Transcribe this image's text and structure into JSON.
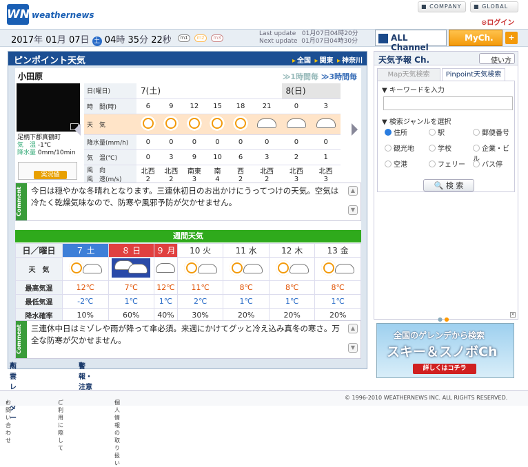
{
  "header": {
    "logo_text": "weathernews",
    "logo_mark": "WN",
    "company": "COMPANY",
    "global": "GLOBAL",
    "login": "ログイン"
  },
  "datebar": {
    "year": "2017",
    "nen": "年",
    "month": "01",
    "gatsu": "月",
    "day": "07",
    "nichi": "日",
    "weekday": "土",
    "hour": "04",
    "ji": "時",
    "minute": "35",
    "fun": "分",
    "second": "22",
    "byo": "秒",
    "pills": [
      "m1",
      "m2",
      "m3"
    ],
    "last_update_label": "Last update",
    "last_update": "01月07日04時20分",
    "next_update_label": "Next update",
    "next_update": "01月07日04時30分",
    "all_channel": "ALL Channel",
    "mych": "MyCh.",
    "plus": "+"
  },
  "main": {
    "title": "ピンポイント天気",
    "breadcrumb": [
      "全国",
      "関東",
      "神奈川"
    ],
    "city": "小田原",
    "tab_1h": "1時間毎",
    "tab_3h": "3時間毎"
  },
  "camera": {
    "station": "足柄下郡真鶴町",
    "temp_label": "気　温",
    "temp": "-1℃",
    "rain_label": "降水量",
    "rain": "0mm/10min",
    "live": "実況値"
  },
  "hourly": {
    "labels": [
      "日(曜日)",
      "時　間(時)",
      "天　気",
      "降水量(mm/h)",
      "気　温(℃)",
      "風　向",
      "風　速(m/s)"
    ],
    "day1": "7(土)",
    "day2": "8(日)",
    "hours": [
      "6",
      "9",
      "12",
      "15",
      "18",
      "21",
      "0",
      "3"
    ],
    "weather": [
      "sun",
      "sun",
      "sun",
      "sun",
      "sun",
      "cloud",
      "cloud",
      "cloud"
    ],
    "precip": [
      "0",
      "0",
      "0",
      "0",
      "0",
      "0",
      "0",
      "0"
    ],
    "temp": [
      "0",
      "3",
      "9",
      "10",
      "6",
      "3",
      "2",
      "1"
    ],
    "wind_dir": [
      "北西",
      "北西",
      "南東",
      "南",
      "西",
      "北西",
      "北西",
      "北西"
    ],
    "wind_speed": [
      "2",
      "2",
      "3",
      "4",
      "2",
      "2",
      "3",
      "3"
    ]
  },
  "comment1": {
    "side": "Comment",
    "text": "今日は穏やかな冬晴れとなります。三連休初日のお出かけにうってつけの天気。空気は冷たく乾燥気味なので、防寒や風邪予防が欠かせません。"
  },
  "weekly": {
    "title": "週間天気",
    "row_labels": [
      "日／曜日",
      "天　気",
      "最高気温",
      "最低気温",
      "降水確率"
    ],
    "days": [
      "７ 土",
      "８ 日",
      "９ 月",
      "10 火",
      "11 水",
      "12 木",
      "13 金"
    ],
    "weather": [
      "sun-cloud",
      "cloud-snow",
      "cloud",
      "sun-cloud",
      "sun-cloud",
      "sun-cloud",
      "sun-cloud"
    ],
    "high": [
      "12℃",
      "7℃",
      "12℃",
      "11℃",
      "8℃",
      "8℃",
      "8℃"
    ],
    "low": [
      "-2℃",
      "1℃",
      "1℃",
      "2℃",
      "1℃",
      "1℃",
      "1℃"
    ],
    "pop": [
      "10%",
      "60%",
      "40%",
      "30%",
      "20%",
      "20%",
      "20%"
    ]
  },
  "comment2": {
    "side": "Comment",
    "text": "三連休中日はミゾレや雨が降って傘必須。来週にかけてグッと冷え込み真冬の寒さ。万全な防寒が欠かせません。"
  },
  "links": {
    "radar": "雨雲レーダー",
    "warning": "警報・注意報"
  },
  "side": {
    "title": "天気予報 Ch.",
    "howto": "使い方",
    "tab_map": "Map天気検索",
    "tab_pinpoint": "Pinpoint天気検索",
    "keyword_label": "▼ キーワードを入力",
    "genre_label": "▼ 検索ジャンルを選択",
    "genres": [
      "住所",
      "駅",
      "郵便番号",
      "観光地",
      "学校",
      "企業・ビル",
      "空港",
      "フェリー",
      "バス停"
    ],
    "search": "検 索"
  },
  "banner": {
    "line1": "全国のゲレンデから検索",
    "line2": "スキー＆スノボCh",
    "line3": "詳しくはコチラ"
  },
  "footer": {
    "inquiry": "お問い合わせ",
    "terms": "ご利用に際して",
    "privacy": "個人情報の取り扱い",
    "copyright": "© 1996-2010 WEATHERNEWS INC. ALL RIGHTS RESERVED."
  }
}
